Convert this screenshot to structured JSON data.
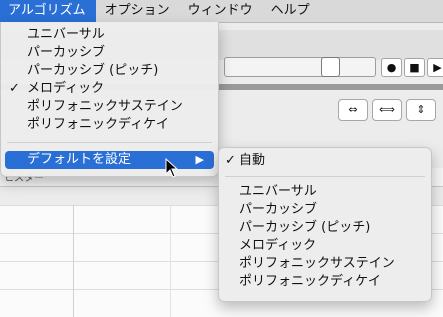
{
  "menubar": {
    "items": [
      "アルゴリズム",
      "オプション",
      "ウィンドウ",
      "ヘルプ"
    ]
  },
  "toolbar": {
    "buttons": [
      "●",
      "■",
      "▶"
    ]
  },
  "view_icons": [
    "⇔",
    "⟺",
    "⇕"
  ],
  "header_text": "ヒスター",
  "main_menu": {
    "items": [
      {
        "label": "ユニバーサル",
        "checked": false
      },
      {
        "label": "パーカッシブ",
        "checked": false
      },
      {
        "label": "パーカッシブ (ピッチ)",
        "checked": false
      },
      {
        "label": "メロディック",
        "checked": true
      },
      {
        "label": "ポリフォニックサステイン",
        "checked": false
      },
      {
        "label": "ポリフォニックディケイ",
        "checked": false
      }
    ],
    "default_item": {
      "label": "デフォルトを設定",
      "arrow": "▶"
    }
  },
  "sub_menu": {
    "auto": {
      "label": "自動",
      "checked": true
    },
    "items": [
      "ユニバーサル",
      "パーカッシブ",
      "パーカッシブ (ピッチ)",
      "メロディック",
      "ポリフォニックサステイン",
      "ポリフォニックディケイ"
    ]
  }
}
